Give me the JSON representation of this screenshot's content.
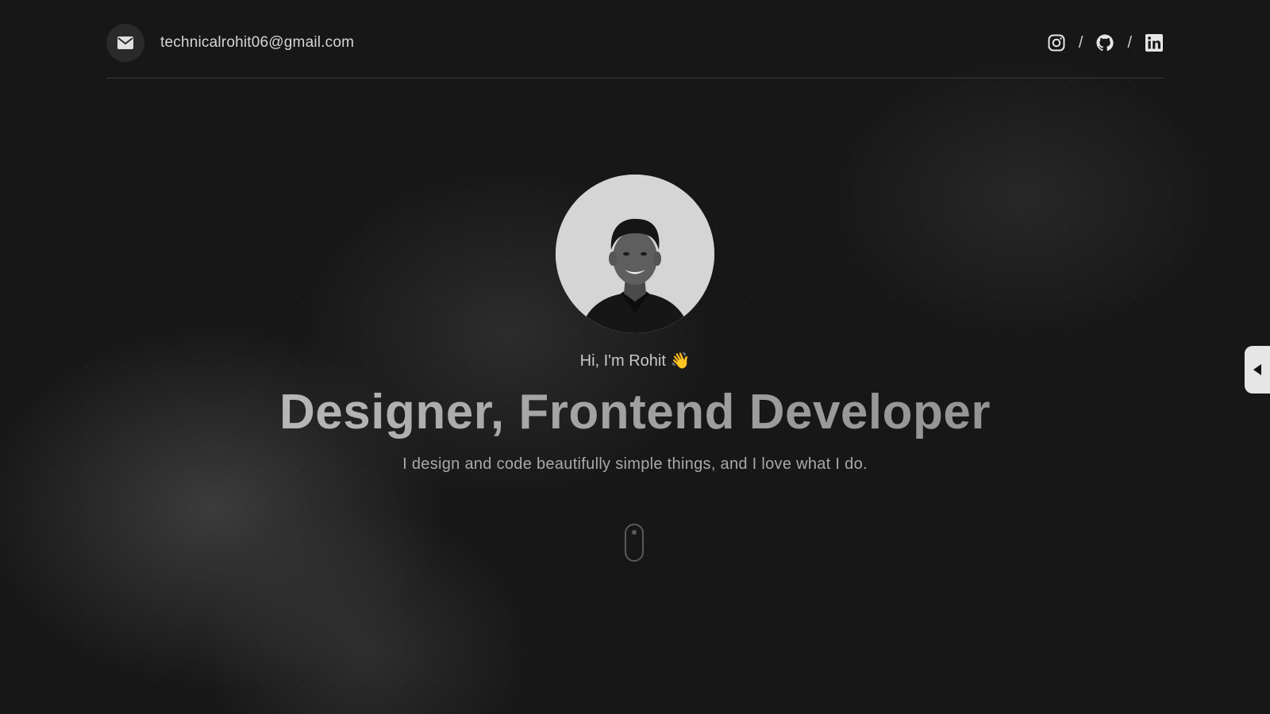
{
  "header": {
    "email": "technicalrohit06@gmail.com",
    "mail_icon": "envelope-icon",
    "socials": [
      {
        "name": "Instagram",
        "icon": "instagram-icon"
      },
      {
        "name": "GitHub",
        "icon": "github-icon"
      },
      {
        "name": "LinkedIn",
        "icon": "linkedin-icon"
      }
    ],
    "separator": "/"
  },
  "hero": {
    "greeting": "Hi, I'm Rohit 👋",
    "title": "Designer, Frontend Developer",
    "subtitle": "I design and code beautifully simple things, and I love what I do."
  },
  "colors": {
    "background": "#171717",
    "text_primary": "#d6d6d6",
    "title_gradient_start": "#c9c9c9",
    "title_gradient_end": "#8a8a8a"
  }
}
